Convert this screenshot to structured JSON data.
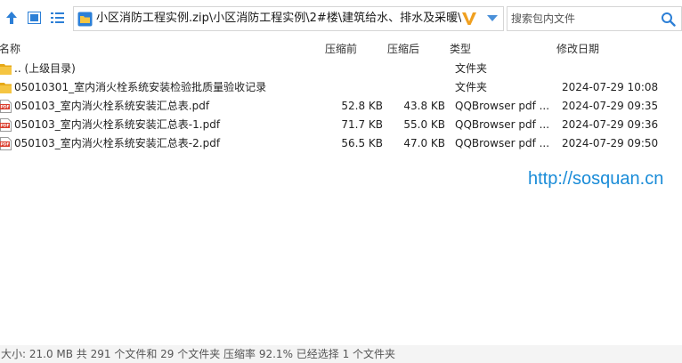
{
  "toolbar": {
    "up_icon": "arrow-up-icon",
    "view_icon_1": "thumbnail-view-icon",
    "view_icon_2": "list-view-icon"
  },
  "address_bar": {
    "path": "小区消防工程实例.zip\\小区消防工程实例\\2#楼\\建筑给水、排水及采暖\\室内给",
    "folder_icon": "folder-icon",
    "badge_icon": "v-badge-icon",
    "dropdown_icon": "chevron-down-icon"
  },
  "search": {
    "placeholder": "搜索包内文件",
    "icon": "search-icon"
  },
  "columns": {
    "name": "名称",
    "size_before": "压缩前",
    "size_after": "压缩后",
    "type": "类型",
    "modified": "修改日期"
  },
  "files": [
    {
      "icon": "folder-icon",
      "name": ".. (上级目录)",
      "size_before": "",
      "size_after": "",
      "type": "文件夹",
      "modified": ""
    },
    {
      "icon": "folder-icon",
      "name": "05010301_室内消火栓系统安装检验批质量验收记录",
      "size_before": "",
      "size_after": "",
      "type": "文件夹",
      "modified": "2024-07-29 10:08"
    },
    {
      "icon": "pdf-icon",
      "name": "050103_室内消火栓系统安装汇总表.pdf",
      "size_before": "52.8 KB",
      "size_after": "43.8 KB",
      "type": "QQBrowser pdf ...",
      "modified": "2024-07-29 09:35"
    },
    {
      "icon": "pdf-icon",
      "name": "050103_室内消火栓系统安装汇总表-1.pdf",
      "size_before": "71.7 KB",
      "size_after": "55.0 KB",
      "type": "QQBrowser pdf ...",
      "modified": "2024-07-29 09:36"
    },
    {
      "icon": "pdf-icon",
      "name": "050103_室内消火栓系统安装汇总表-2.pdf",
      "size_before": "56.5 KB",
      "size_after": "47.0 KB",
      "type": "QQBrowser pdf ...",
      "modified": "2024-07-29 09:50"
    }
  ],
  "watermark": "http://sosquan.cn",
  "status": "大小: 21.0 MB 共 291 个文件和 29 个文件夹 压缩率 92.1% 已经选择 1 个文件夹",
  "colors": {
    "folder": "#f1c232",
    "pdf": "#d93b2b",
    "accent": "#2c7fd6",
    "watermark": "#1a8cd8"
  }
}
